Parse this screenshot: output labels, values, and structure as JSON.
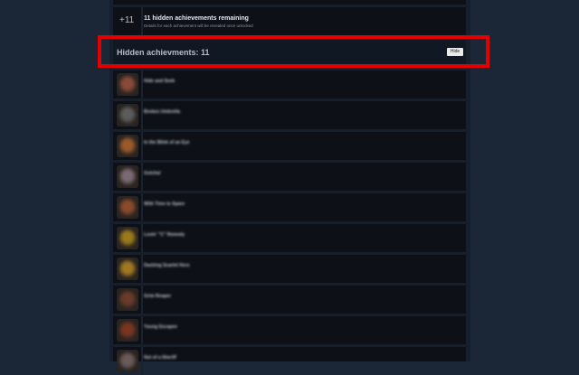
{
  "summary": {
    "plus_count": "+11",
    "title": "11 hidden achievements remaining",
    "subtitle": "Details for each achievement will be revealed once unlocked"
  },
  "hidden_section": {
    "title": "Hidden achievments: 11",
    "hide_label": "Hide"
  },
  "achievements": [
    {
      "name": "Hide and Seek",
      "color": "#8a4a3a"
    },
    {
      "name": "Broken Umbrella",
      "color": "#5c5c5c"
    },
    {
      "name": "In the Blink of an Eye",
      "color": "#9a5a2a"
    },
    {
      "name": "Gotcha!",
      "color": "#7a6a72"
    },
    {
      "name": "With Time to Spare",
      "color": "#8a4a2a"
    },
    {
      "name": "Lovin' \"C\" Remedy",
      "color": "#9a7a1a"
    },
    {
      "name": "Dashing Scarlet Hero",
      "color": "#a07820"
    },
    {
      "name": "Grim Reaper",
      "color": "#6a3a2a"
    },
    {
      "name": "Young Escapee",
      "color": "#7a3420"
    },
    {
      "name": "Not of a Sheriff",
      "color": "#6a5a5a"
    }
  ]
}
